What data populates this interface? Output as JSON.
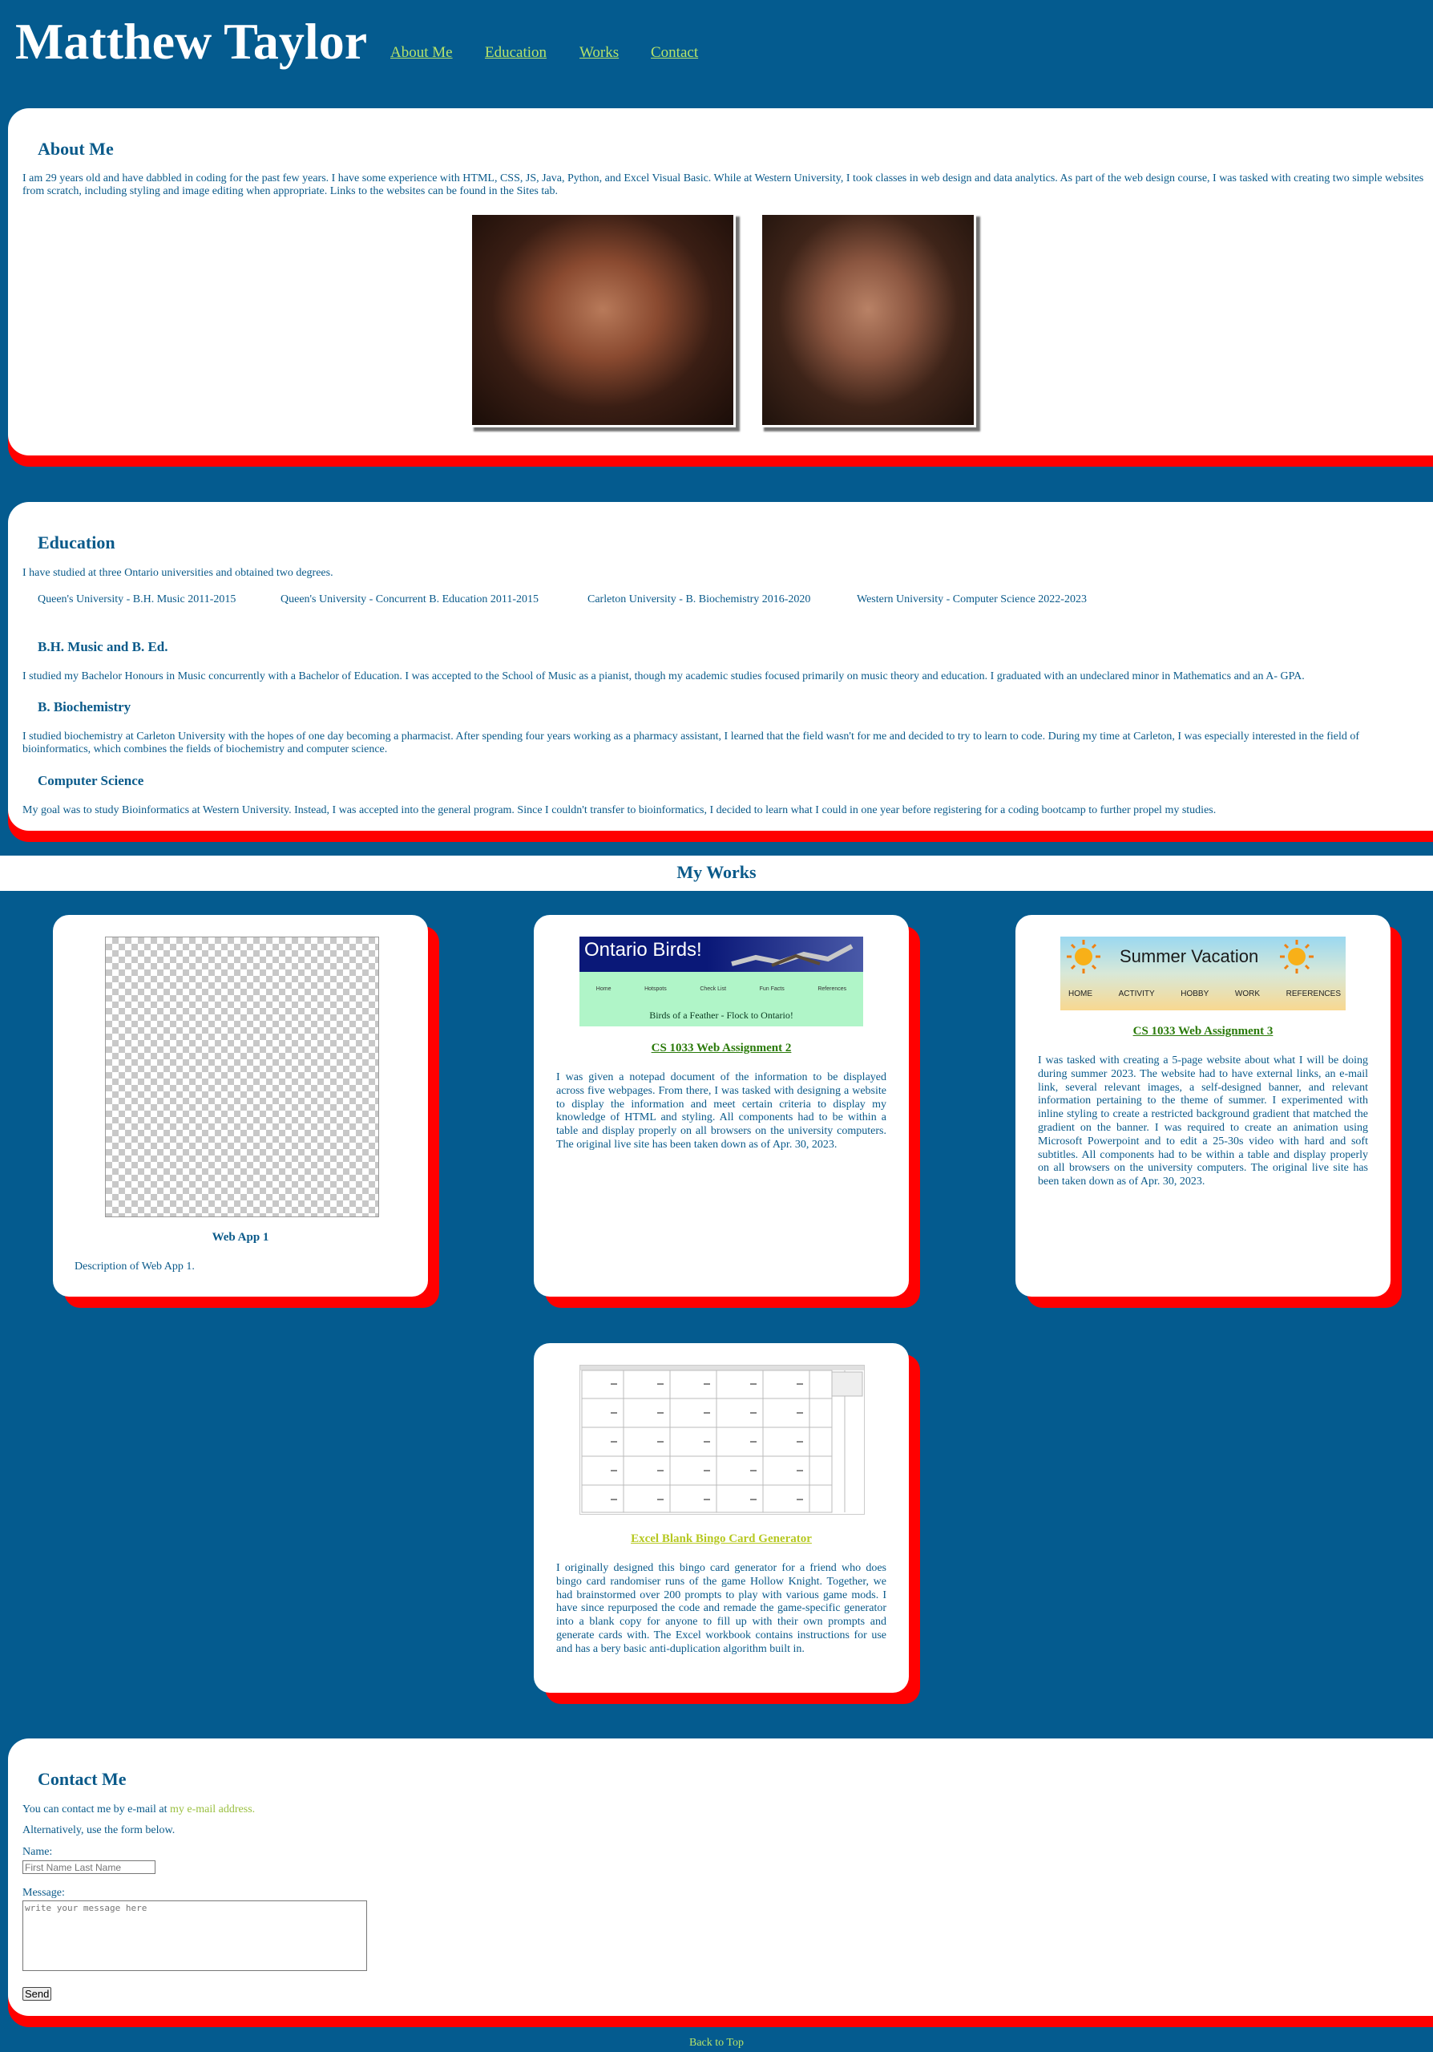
{
  "header": {
    "title": "Matthew Taylor",
    "nav": [
      "About Me",
      "Education",
      "Works",
      "Contact"
    ]
  },
  "about": {
    "heading": "About Me",
    "text": "I am 29 years old and have dabbled in coding for the past few years. I have some experience with HTML, CSS, JS, Java, Python, and Excel Visual Basic. While at Western University, I took classes in web design and data analytics. As part of the web design course, I was tasked with creating two simple websites from scratch, including styling and image editing when appropriate. Links to the websites can be found in the Sites tab."
  },
  "education": {
    "heading": "Education",
    "intro": "I have studied at three Ontario universities and obtained two degrees.",
    "degrees": [
      "Queen's University - B.H. Music 2011-2015",
      "Queen's University - Concurrent B. Education 2011-2015",
      "Carleton University - B. Biochemistry 2016-2020",
      "Western University - Computer Science 2022-2023"
    ],
    "sections": [
      {
        "title": "B.H. Music and B. Ed.",
        "text": "I studied my Bachelor Honours in Music concurrently with a Bachelor of Education. I was accepted to the School of Music as a pianist, though my academic studies focused primarily on music theory and education. I graduated with an undeclared minor in Mathematics and an A- GPA."
      },
      {
        "title": "B. Biochemistry",
        "text": "I studied biochemistry at Carleton University with the hopes of one day becoming a pharmacist. After spending four years working as a pharmacy assistant, I learned that the field wasn't for me and decided to try to learn to code. During my time at Carleton, I was especially interested in the field of bioinformatics, which combines the fields of biochemistry and computer science."
      },
      {
        "title": "Computer Science",
        "text": "My goal was to study Bioinformatics at Western University. Instead, I was accepted into the general program. Since I couldn't transfer to bioinformatics, I decided to learn what I could in one year before registering for a coding bootcamp to further propel my studies."
      }
    ]
  },
  "works": {
    "heading": "My Works",
    "cards": [
      {
        "title": "Web App 1",
        "desc": "Description of Web App 1."
      },
      {
        "title": "CS 1033 Web Assignment 2",
        "desc": "I was given a notepad document of the information to be displayed across five webpages. From there, I was tasked with designing a website to display the information and meet certain criteria to display my knowledge of HTML and styling. All components had to be within a table and display properly on all browsers on the university computers. The original live site has been taken down as of Apr. 30, 2023.",
        "thumb": {
          "banner": "Ontario Birds!",
          "nav": [
            "Home",
            "Hotspots",
            "Check List",
            "Fun Facts",
            "References"
          ],
          "tagline": "Birds of a Feather - Flock to Ontario!"
        }
      },
      {
        "title": "CS 1033 Web Assignment 3",
        "desc": "I was tasked with creating a 5-page website about what I will be doing during summer 2023. The website had to have external links, an e-mail link, several relevant images, a self-designed banner, and relevant information pertaining to the theme of summer. I experimented with inline styling to create a restricted background gradient that matched the gradient on the banner. I was required to create an animation using Microsoft Powerpoint and to edit a 25-30s video with hard and soft subtitles. All components had to be within a table and display properly on all browsers on the university computers. The original live site has been taken down as of Apr. 30, 2023.",
        "thumb": {
          "banner": "Summer Vacation",
          "nav": [
            "HOME",
            "ACTIVITY",
            "HOBBY",
            "WORK",
            "REFERENCES"
          ]
        }
      },
      {
        "title": "Excel Blank Bingo Card Generator",
        "desc": "I originally designed this bingo card generator for a friend who does bingo card randomiser runs of the game Hollow Knight. Together, we had brainstormed over 200 prompts to play with various game mods. I have since repurposed the code and remade the game-specific generator into a blank copy for anyone to fill up with their own prompts and generate cards with. The Excel workbook contains instructions for use and has a bery basic anti-duplication algorithm built in."
      }
    ]
  },
  "contact": {
    "heading": "Contact Me",
    "email_prefix": "You can contact me by e-mail at ",
    "email_link": "my e-mail address.",
    "alt": "Alternatively, use the form below.",
    "name_label": "Name:",
    "name_placeholder": "First Name Last Name",
    "message_label": "Message:",
    "message_placeholder": "write your message here",
    "send_label": "Send"
  },
  "footer": {
    "back_to_top": "Back to Top"
  },
  "colors": {
    "background": "#045b8f",
    "panel": "#ffffff",
    "shadow": "#ff0000",
    "link": "#b6e36a",
    "text": "#0a5a8a"
  }
}
